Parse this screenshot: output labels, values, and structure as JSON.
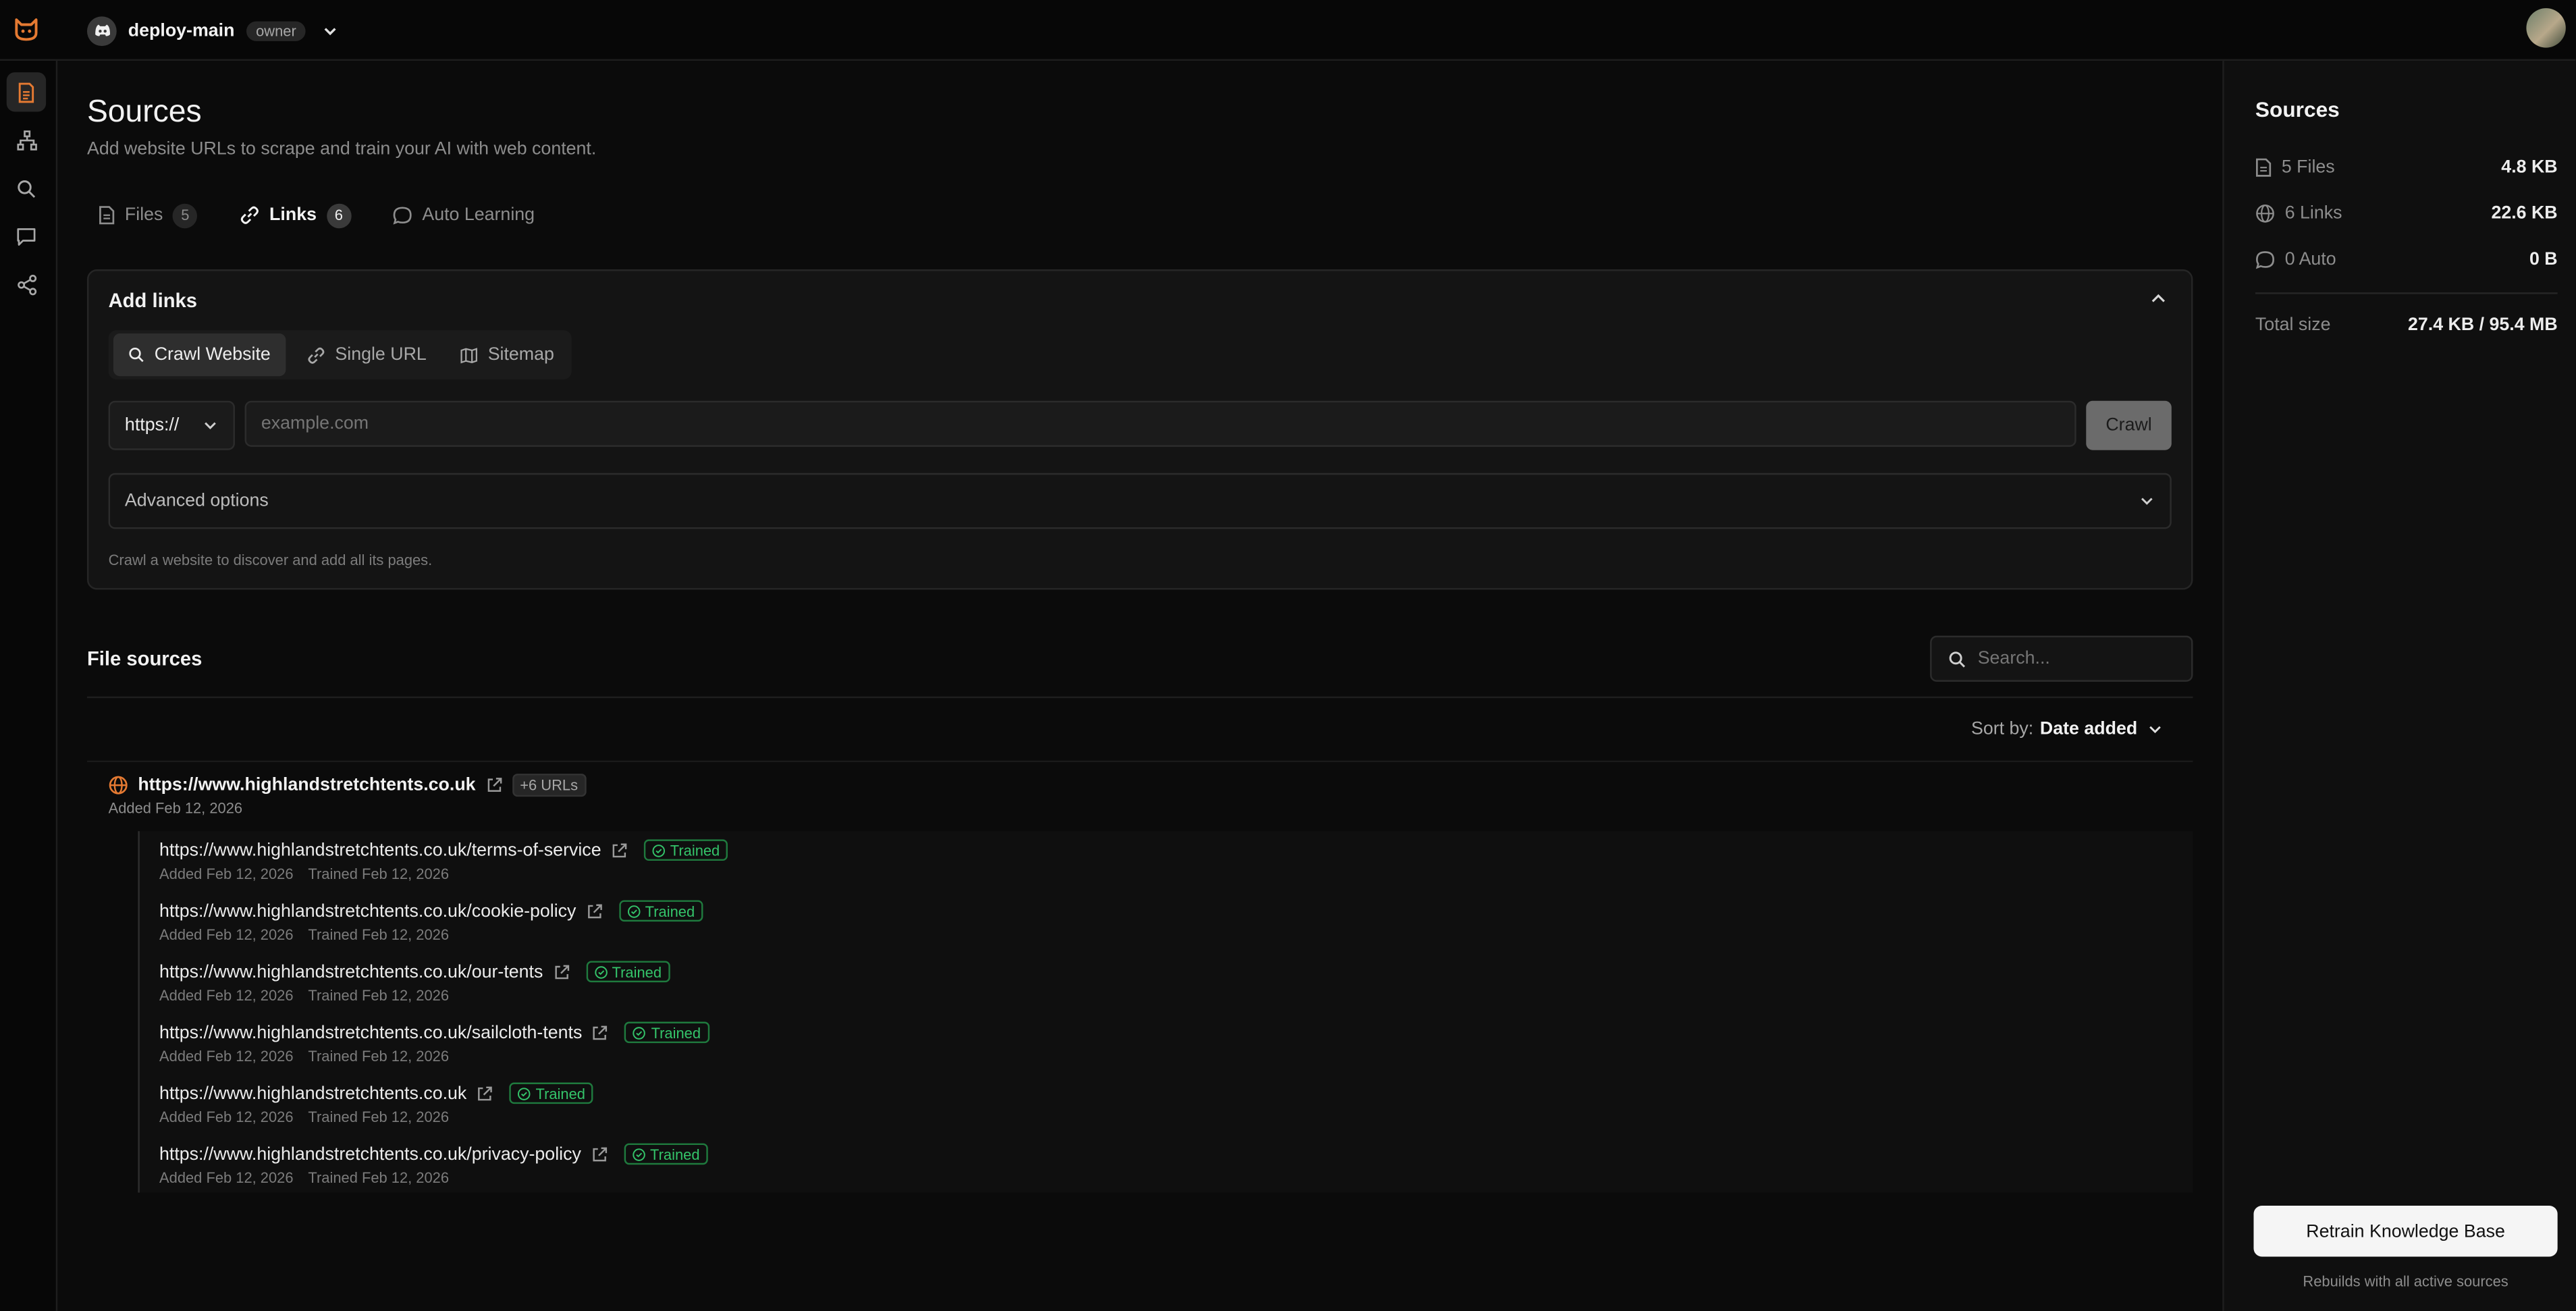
{
  "workspace": {
    "name": "deploy-main",
    "role": "owner"
  },
  "page": {
    "title": "Sources",
    "subtitle": "Add website URLs to scrape and train your AI with web content."
  },
  "tabs": [
    {
      "label": "Files",
      "count": "5"
    },
    {
      "label": "Links",
      "count": "6"
    },
    {
      "label": "Auto Learning",
      "count": ""
    }
  ],
  "add_links": {
    "title": "Add links",
    "modes": [
      "Crawl Website",
      "Single URL",
      "Sitemap"
    ],
    "protocol": "https://",
    "url_placeholder": "example.com",
    "crawl_label": "Crawl",
    "advanced_label": "Advanced options",
    "hint": "Crawl a website to discover and add all its pages."
  },
  "file_sources": {
    "title": "File sources",
    "search_placeholder": "Search...",
    "sort_label": "Sort by:",
    "sort_value": "Date added",
    "group": {
      "url": "https://www.highlandstretchtents.co.uk",
      "extra": "+6 URLs",
      "added": "Added Feb 12, 2026"
    },
    "items": [
      {
        "url": "https://www.highlandstretchtents.co.uk/terms-of-service",
        "status": "Trained",
        "added": "Added Feb 12, 2026",
        "trained": "Trained Feb 12, 2026"
      },
      {
        "url": "https://www.highlandstretchtents.co.uk/cookie-policy",
        "status": "Trained",
        "added": "Added Feb 12, 2026",
        "trained": "Trained Feb 12, 2026"
      },
      {
        "url": "https://www.highlandstretchtents.co.uk/our-tents",
        "status": "Trained",
        "added": "Added Feb 12, 2026",
        "trained": "Trained Feb 12, 2026"
      },
      {
        "url": "https://www.highlandstretchtents.co.uk/sailcloth-tents",
        "status": "Trained",
        "added": "Added Feb 12, 2026",
        "trained": "Trained Feb 12, 2026"
      },
      {
        "url": "https://www.highlandstretchtents.co.uk",
        "status": "Trained",
        "added": "Added Feb 12, 2026",
        "trained": "Trained Feb 12, 2026"
      },
      {
        "url": "https://www.highlandstretchtents.co.uk/privacy-policy",
        "status": "Trained",
        "added": "Added Feb 12, 2026",
        "trained": "Trained Feb 12, 2026"
      }
    ]
  },
  "summary": {
    "title": "Sources",
    "rows": [
      {
        "label": "5 Files",
        "value": "4.8 KB",
        "icon": "file-icon"
      },
      {
        "label": "6 Links",
        "value": "22.6 KB",
        "icon": "globe-icon"
      },
      {
        "label": "0 Auto",
        "value": "0 B",
        "icon": "chat-icon"
      }
    ],
    "total_label": "Total size",
    "total_value": "27.4 KB / 95.4 MB",
    "retrain_label": "Retrain Knowledge Base",
    "retrain_hint": "Rebuilds with all active sources"
  },
  "colors": {
    "accent": "#e57a32",
    "trained": "#34c46a",
    "background": "#0b0b0b"
  }
}
